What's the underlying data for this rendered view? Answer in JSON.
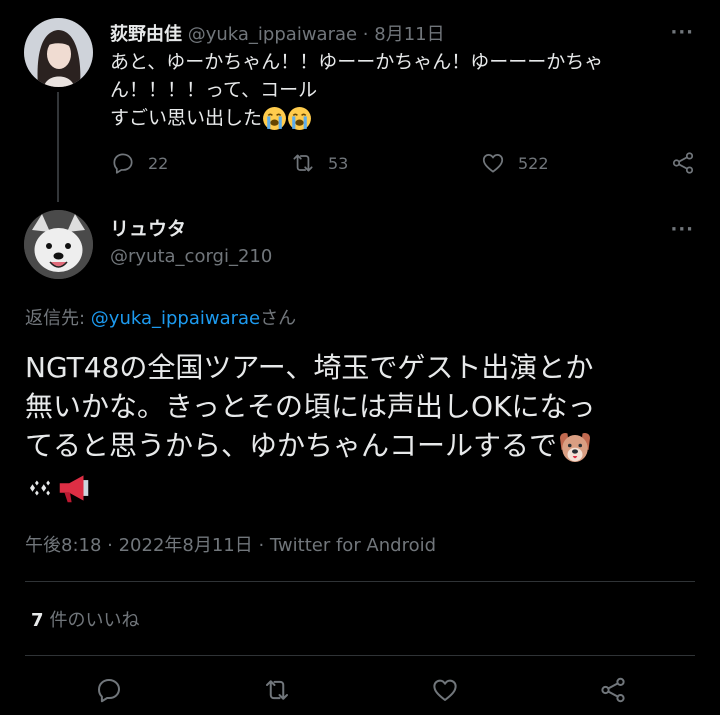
{
  "parent_tweet": {
    "author_name": "荻野由佳",
    "handle": "@yuka_ippaiwarae",
    "separator": " · ",
    "date": "8月11日",
    "more": "···",
    "text_lines": [
      "あと、ゆーかちゃん！！ゆーーかちゃん！ゆーーーかちゃ",
      "ん！！！！って、コール",
      "すごい思い出した"
    ],
    "emojis": [
      "loudly-crying-face",
      "loudly-crying-face"
    ],
    "actions": {
      "replies": "22",
      "retweets": "53",
      "likes": "522"
    }
  },
  "main_tweet": {
    "author_name": "リュウタ",
    "handle": "@ryuta_corgi_210",
    "more": "···",
    "reply_prefix": "返信先: ",
    "reply_handle": "@yuka_ippaiwarae",
    "reply_suffix": "さん",
    "text_lines": [
      "NGT48の全国ツアー、埼玉でゲスト出演とか",
      "無いかな。きっとその頃には声出しOKになっ",
      "てると思うから、ゆかちゃんコールするで"
    ],
    "emojis": [
      "dog-face",
      "sparkles",
      "megaphone"
    ],
    "timestamp": "午後8:18 · 2022年8月11日 · Twitter for Android",
    "likes_count": "7",
    "likes_label": "件のいいね"
  },
  "colors": {
    "background": "#000000",
    "text": "#e7e9ea",
    "secondary": "#71767b",
    "link": "#1d9bf0",
    "divider": "#2f3336"
  }
}
